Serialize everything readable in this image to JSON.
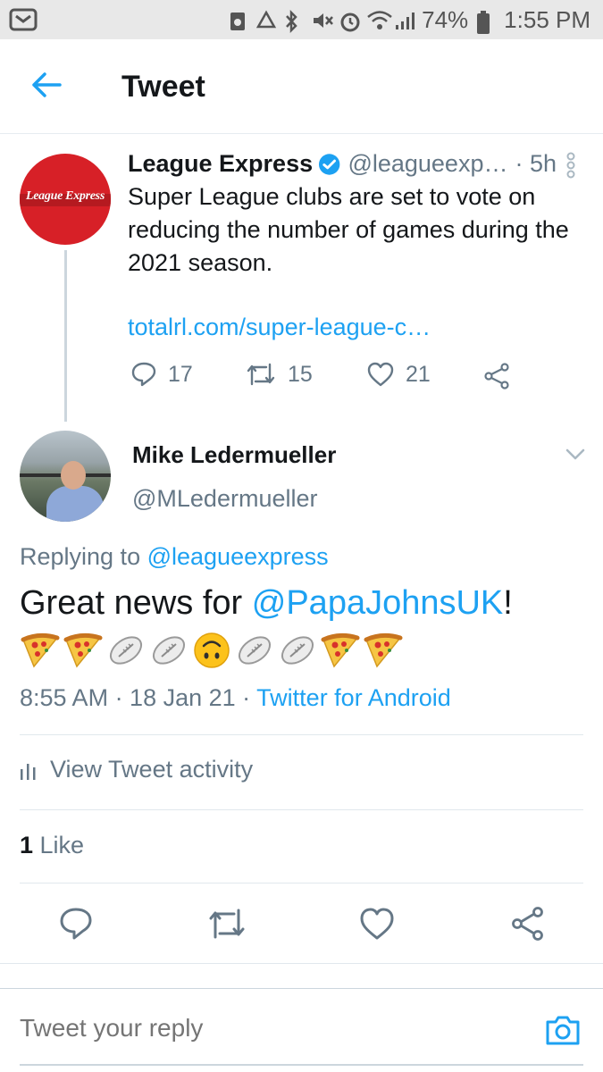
{
  "status_bar": {
    "battery": "74%",
    "time": "1:55 PM"
  },
  "header": {
    "title": "Tweet"
  },
  "quoted_tweet": {
    "avatar_logo_text": "League Express",
    "name": "League Express",
    "handle": "@leagueexp…",
    "time_ago": "· 5h",
    "text": "Super League clubs are set to vote on reducing the number of games during the 2021 season.",
    "link": "totalrl.com/super-league-c…",
    "reply_count": "17",
    "retweet_count": "15",
    "like_count": "21"
  },
  "reply_tweet": {
    "name": "Mike Ledermueller",
    "handle": "@MLedermueller",
    "replying_prefix": "Replying to ",
    "replying_to": "@leagueexpress",
    "text_before": "Great news for ",
    "mention": "@PapaJohnsUK",
    "text_after": "!",
    "emojis": [
      "pizza",
      "pizza",
      "rugby-ball",
      "rugby-ball",
      "upside-down-face",
      "rugby-ball",
      "rugby-ball",
      "pizza",
      "pizza"
    ],
    "timestamp": "8:55 AM · 18 Jan 21 · ",
    "source": "Twitter for Android"
  },
  "activity": {
    "label": "View Tweet activity"
  },
  "likes": {
    "count": "1",
    "label": " Like"
  },
  "compose": {
    "placeholder": "Tweet your reply"
  },
  "colors": {
    "accent": "#1da1f2",
    "secondary_text": "#657786",
    "primary_text": "#14171a"
  }
}
